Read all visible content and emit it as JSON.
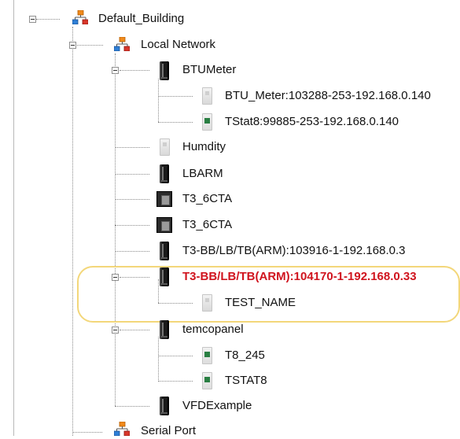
{
  "tree": {
    "root": {
      "label": "Default_Building",
      "icon": "network-icon"
    },
    "local_network": {
      "label": "Local Network",
      "icon": "network-icon"
    },
    "items": {
      "btumeter": "BTUMeter",
      "btu_meter": "BTU_Meter:103288-253-192.168.0.140",
      "tstat8": "TStat8:99885-253-192.168.0.140",
      "humdity": "Humdity",
      "lbarm": "LBARM",
      "t3_6cta_1": "T3_6CTA",
      "t3_6cta_2": "T3_6CTA",
      "t3_bb_103916": "T3-BB/LB/TB(ARM):103916-1-192.168.0.3",
      "t3_bb_104170": "T3-BB/LB/TB(ARM):104170-1-192.168.0.33",
      "test_name": "TEST_NAME",
      "temcopanel": "temcopanel",
      "t8_245": "T8_245",
      "tstat8_child": "TSTAT8",
      "vfdexample": "VFDExample"
    },
    "serial_port": {
      "label": "Serial Port",
      "icon": "network-icon"
    },
    "colors": {
      "alarm_text": "#d0141e",
      "highlight": "#f3d77a",
      "device_led": "#2a7f43"
    }
  }
}
